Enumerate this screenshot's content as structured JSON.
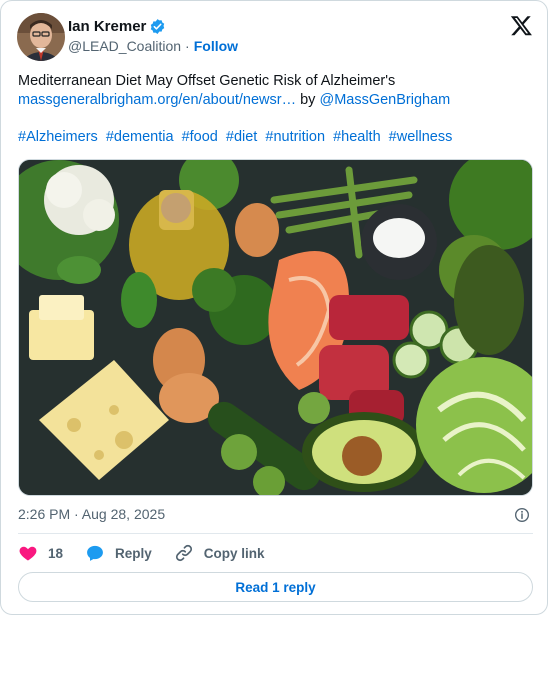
{
  "author": {
    "name": "Ian Kremer",
    "handle": "@LEAD_Coalition",
    "separator": "·",
    "follow_label": "Follow"
  },
  "tweet": {
    "line1": "Mediterranean Diet May Offset Genetic Risk of Alzheimer's",
    "link_text": "massgeneralbrigham.org/en/about/newsr…",
    "by_text": "by",
    "mention": "@MassGenBrigham",
    "hashtags": [
      "#Alzheimers",
      "#dementia",
      "#food",
      "#diet",
      "#nutrition",
      "#health",
      "#wellness"
    ]
  },
  "meta": {
    "timestamp": "2:26 PM · Aug 28, 2025"
  },
  "actions": {
    "likes_count": "18",
    "reply_label": "Reply",
    "copy_link_label": "Copy link"
  },
  "read_replies_label": "Read 1 reply",
  "icons": {
    "verified": "verified-badge-icon",
    "logo": "x-logo-icon",
    "info": "info-icon",
    "like": "heart-icon",
    "reply": "reply-bubble-icon",
    "copy_link": "link-icon"
  },
  "colors": {
    "accent": "#006fd6",
    "like": "#f91880",
    "verified": "#1d9bf0",
    "reply": "#1d9bf0"
  }
}
